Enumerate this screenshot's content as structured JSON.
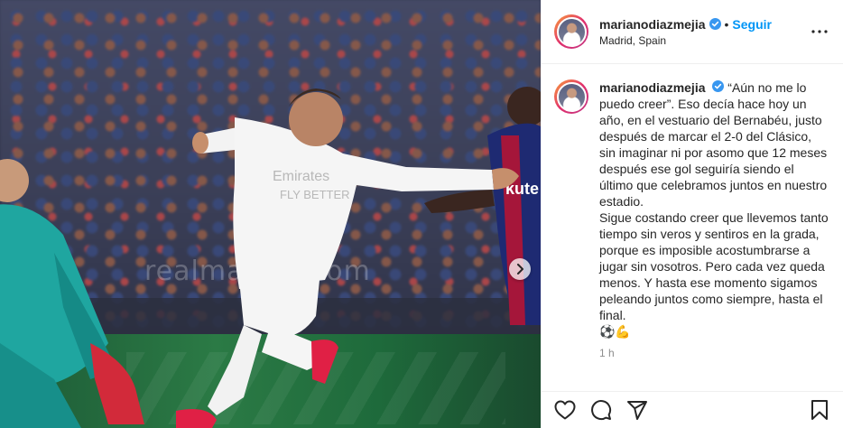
{
  "post": {
    "photo": {
      "watermark": "realmadrid.com"
    },
    "header": {
      "username": "marianodiazmejia",
      "verified": true,
      "separator": "•",
      "follow_label": "Seguir",
      "location": "Madrid, Spain",
      "more_icon": "more-options-icon"
    },
    "caption": {
      "username": "marianodiazmejia",
      "text": "“Aún no me lo puedo creer”. Eso decía hace hoy un año, en el vestuario del Bernabéu, justo después de marcar el 2-0 del Clásico, sin imaginar ni por asomo que 12 meses después ese gol seguiría siendo el último que celebramos juntos en nuestro estadio.\nSigue costando creer que llevemos tanto tiempo sin veros y sentiros en la grada, porque es imposible acostumbrarse a jugar sin vosotros. Pero cada vez queda menos. Y hasta ese momento sigamos peleando juntos como siempre, hasta el final.",
      "emoji": "⚽💪",
      "time": "1 h"
    },
    "actions": [
      "heart-icon",
      "comment-icon",
      "share-icon",
      "bookmark-icon"
    ],
    "colors": {
      "accent": "#0095f6",
      "verified": "#3897f0",
      "text": "#262626",
      "muted": "#8e8e8e"
    }
  }
}
